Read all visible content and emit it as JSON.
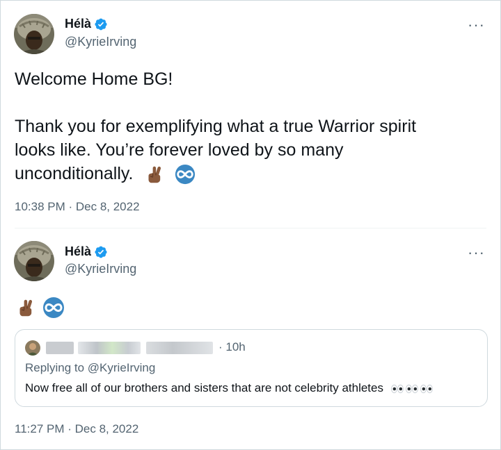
{
  "tweets": [
    {
      "author_name": "Hélà",
      "author_handle": "@KyrieIrving",
      "text_line1": "Welcome Home BG!",
      "text_line2": "Thank you for exemplifying what a true Warrior spirit",
      "text_line3": "looks like. You’re forever loved by so many",
      "text_line4": "unconditionally.",
      "timestamp": "10:38 PM · Dec 8, 2022",
      "more_label": "···"
    },
    {
      "author_name": "Hélà",
      "author_handle": "@KyrieIrving",
      "timestamp": "11:27 PM · Dec 8, 2022",
      "more_label": "···",
      "quote": {
        "time": "· 10h",
        "replying_prefix": "Replying to ",
        "replying_handle": "@KyrieIrving",
        "text": "Now free all of our brothers and sisters that are not celebrity athletes"
      }
    }
  ],
  "icons": [
    "verified-badge-icon",
    "crossed-fingers-emoji",
    "infinity-emoji",
    "eyes-emoji"
  ],
  "colors": {
    "accent": "#1d9bf0",
    "text": "#0f1419",
    "secondary": "#536471",
    "border": "#cfd9de"
  }
}
